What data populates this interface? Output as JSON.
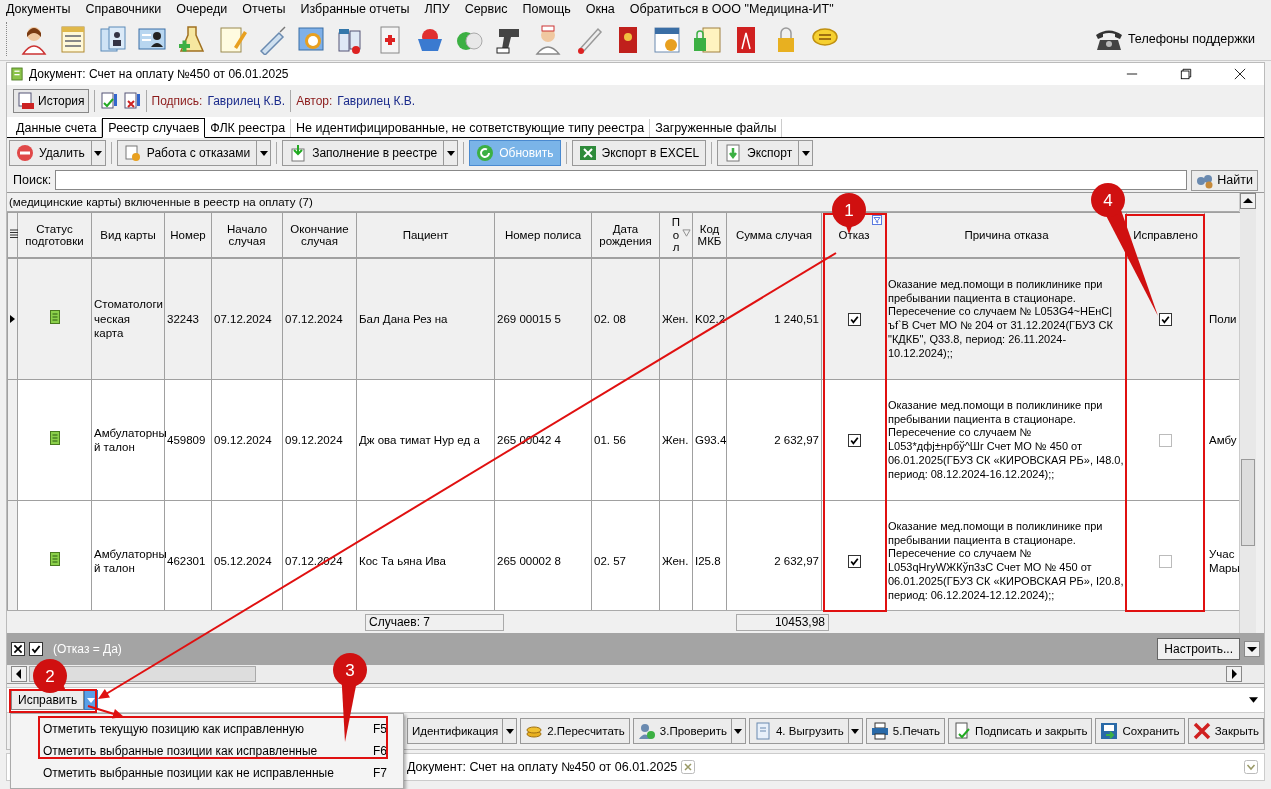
{
  "menu": [
    "Документы",
    "Справочники",
    "Очереди",
    "Отчеты",
    "Избранные отчеты",
    "ЛПУ",
    "Сервис",
    "Помощь",
    "Окна",
    "Обратиться в ООО \"Медицина-ИТ\""
  ],
  "support": "Телефоны поддержки",
  "window": {
    "title": "Документ: Счет на оплату №450 от 06.01.2025"
  },
  "history_button": "История",
  "signature": {
    "label": "Подпись:",
    "value": "Гаврилец К.В."
  },
  "author": {
    "label": "Автор:",
    "value": "Гаврилец К.В."
  },
  "tabs": [
    {
      "label": "Данные счета",
      "selected": false
    },
    {
      "label": "Реестр случаев",
      "selected": true
    },
    {
      "label": "ФЛК реестра",
      "selected": false
    },
    {
      "label": "Не идентифицированные, не сответствующие типу реестра",
      "selected": false
    },
    {
      "label": "Загруженные файлы",
      "selected": false
    }
  ],
  "actions": [
    {
      "label": "Удалить",
      "dropdown": true,
      "highlighted": false
    },
    {
      "label": "Работа с отказами",
      "dropdown": true,
      "highlighted": false
    },
    {
      "label": "Заполнение в реестре",
      "dropdown": true,
      "highlighted": false
    },
    {
      "label": "Обновить",
      "dropdown": false,
      "highlighted": true
    },
    {
      "label": "Экспорт в EXCEL",
      "dropdown": false,
      "highlighted": false
    },
    {
      "label": "Экспорт",
      "dropdown": true,
      "highlighted": false
    }
  ],
  "search": {
    "label": "Поиск:",
    "button": "Найти"
  },
  "group_caption": "(медицинские карты) включенные в реестр на оплату (7)",
  "table": {
    "columns": [
      "Статус подготовки",
      "Вид карты",
      "Номер",
      "Начало случая",
      "Окончание случая",
      "Пациент",
      "Номер полиса",
      "Дата рождения",
      "Пол",
      "Код МКБ",
      "Сумма случая",
      "Отказ",
      "Причина отказа",
      "Исправлено"
    ],
    "rows": [
      {
        "current": true,
        "card_type": "Стоматологи ческая карта",
        "number": "32243",
        "start": "07.12.2024",
        "end": "07.12.2024",
        "patient": "Бал Дана Рез на",
        "policy": "269 00015 5",
        "birth": "02. 08",
        "sex": "Жен.",
        "icd": "K02.2",
        "sum": "1 240,51",
        "refused": true,
        "reason": "Оказание мед.помощи в поликлинике при пребывании пациента в стационаре. Пересечение со случаем № L053G4~HEнС|ъf`B Счет МО № 204 от 31.12.2024(ГБУЗ СК \"КДКБ\", Q33.8, период: 26.11.2024-10.12.2024);;",
        "fixed": true,
        "column_16": "Поли"
      },
      {
        "current": false,
        "card_type": "Амбулаторны й талон",
        "number": "459809",
        "start": "09.12.2024",
        "end": "09.12.2024",
        "patient": "Дж ова тимат Нур ед а",
        "policy": "265 00042 4",
        "birth": "01. 56",
        "sex": "Жен.",
        "icd": "G93.4",
        "sum": "2 632,97",
        "refused": true,
        "reason": "Оказание мед.помощи в поликлинике при пребывании пациента в стационаре. Пересечение со случаем № L053*дфj±нрбў^Шr Счет МО № 450 от 06.01.2025(ГБУЗ СК «КИРОВСКАЯ РБ», I48.0, период: 08.12.2024-16.12.2024);;",
        "fixed": false,
        "column_16": "Амбу"
      },
      {
        "current": false,
        "card_type": "Амбулаторны й талон",
        "number": "462301",
        "start": "05.12.2024",
        "end": "07.12.2024",
        "patient": "Кос Та ьяна Ива",
        "policy": "265 00002 8",
        "birth": "02. 57",
        "sex": "Жен.",
        "icd": "I25.8",
        "sum": "2 632,97",
        "refused": true,
        "reason": "Оказание мед.помощи в поликлинике при пребывании пациента в стационаре. Пересечение со случаем № L053qHryWЖКўп3зС Счет МО № 450 от 06.01.2025(ГБУЗ СК «КИРОВСКАЯ РБ», I20.8, период: 06.12.2024-12.12.2024);;",
        "fixed": false,
        "column_16": "Учас Мары"
      }
    ]
  },
  "totals": {
    "count": "Случаев: 7",
    "sum": "10453,98"
  },
  "filter": {
    "enabled": true,
    "text": "(Отказ = Да)",
    "button": "Настроить..."
  },
  "fix_button": "Исправить",
  "fix_menu": [
    {
      "label": "Отметить текущую позицию как исправленную",
      "shortcut": "F5"
    },
    {
      "label": "Отметить выбранные позиции как исправленные",
      "shortcut": "F6"
    },
    {
      "label": "Отметить выбранные позиции как не исправленные",
      "shortcut": "F7"
    }
  ],
  "bottom_buttons": [
    {
      "label": "Идентификация",
      "dropdown": true
    },
    {
      "label": "2.Пересчитать",
      "dropdown": false
    },
    {
      "label": "3.Проверить",
      "dropdown": true
    },
    {
      "label": "4. Выгрузить",
      "dropdown": true
    },
    {
      "label": "5.Печать",
      "dropdown": false
    },
    {
      "label": "Подписать и закрыть",
      "dropdown": false
    },
    {
      "label": "Сохранить",
      "dropdown": false
    },
    {
      "label": "Закрыть",
      "dropdown": false
    }
  ],
  "taskbar": {
    "label": "Документ: Счет на оплату №450 от 06.01.2025"
  },
  "annotations": [
    {
      "label": "1"
    },
    {
      "label": "2"
    },
    {
      "label": "3"
    },
    {
      "label": "4"
    }
  ]
}
